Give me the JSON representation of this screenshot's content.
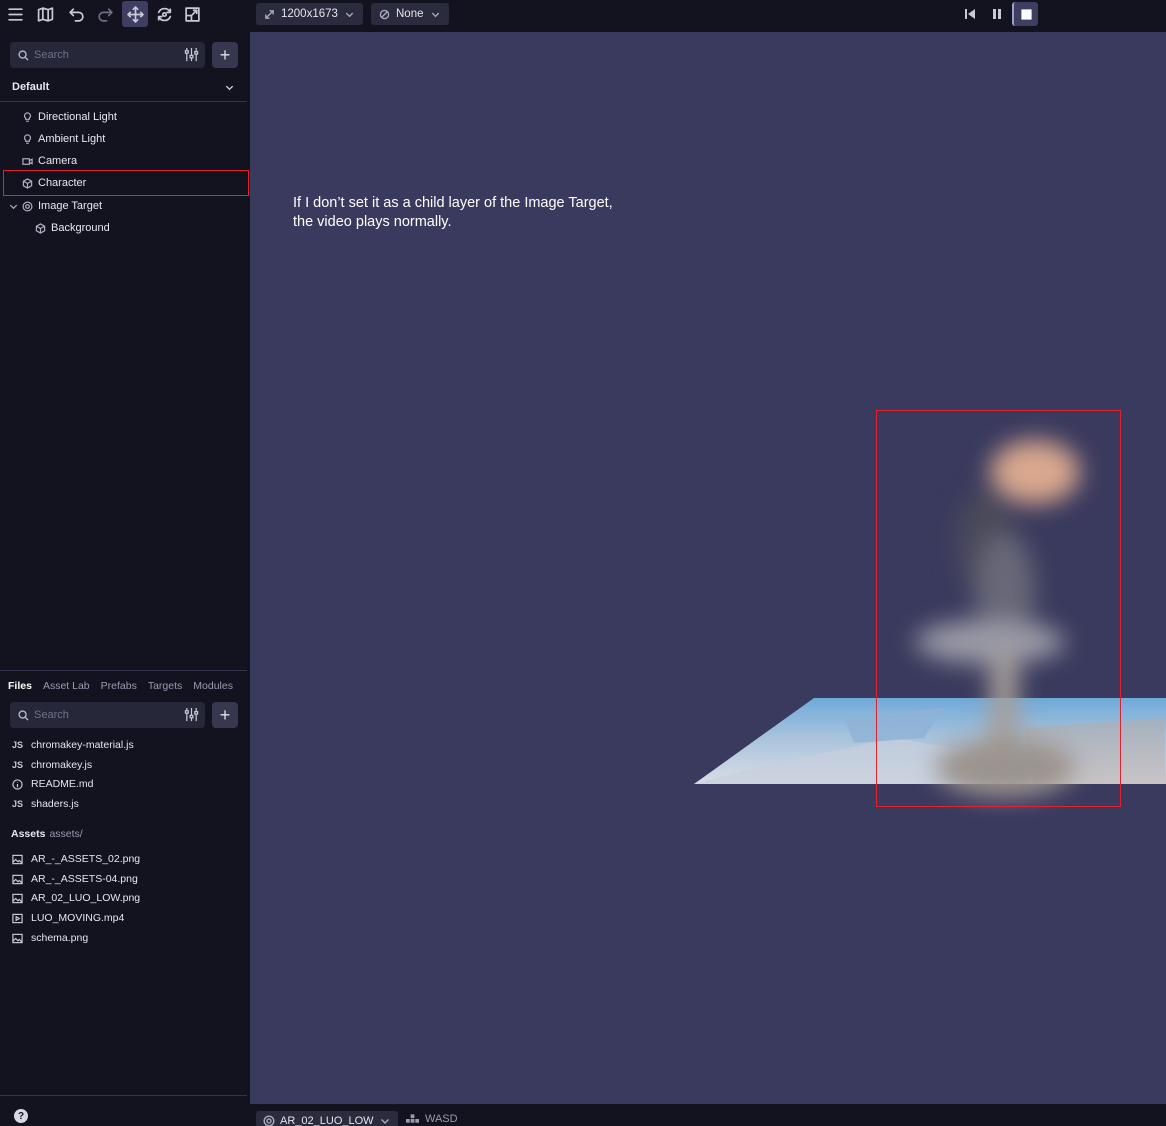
{
  "toolbar": {
    "resolution": "1200x1673",
    "camera_mode": "None",
    "icons": [
      "menu-icon",
      "map-icon",
      "undo-icon",
      "redo-icon",
      "move-icon",
      "orbit-icon",
      "scale-icon"
    ],
    "playback_icons": [
      "skip-back-icon",
      "pause-icon",
      "stop-icon"
    ]
  },
  "hierarchy": {
    "search_placeholder": "Search",
    "add_label": "+",
    "scene_name": "Default",
    "items": [
      {
        "label": "Directional Light",
        "icon": "bulb-icon"
      },
      {
        "label": "Ambient Light",
        "icon": "bulb-icon"
      },
      {
        "label": "Camera",
        "icon": "camera-icon"
      },
      {
        "label": "Character",
        "icon": "cube-icon"
      },
      {
        "label": "Image Target",
        "icon": "target-icon"
      },
      {
        "label": "Background",
        "icon": "cube-icon"
      }
    ]
  },
  "files_panel": {
    "tabs": [
      "Files",
      "Asset Lab",
      "Prefabs",
      "Targets",
      "Modules"
    ],
    "active_tab": "Files",
    "search_placeholder": "Search",
    "add_label": "+",
    "files": [
      {
        "name": "chromakey-material.js",
        "type": "JS"
      },
      {
        "name": "chromakey.js",
        "type": "JS"
      },
      {
        "name": "README.md",
        "type": "info"
      },
      {
        "name": "shaders.js",
        "type": "JS"
      }
    ],
    "assets_title": "Assets",
    "assets_path": "assets/",
    "assets": [
      {
        "name": "AR_-_ASSETS_02.png",
        "type": "image"
      },
      {
        "name": "AR_-_ASSETS-04.png",
        "type": "image"
      },
      {
        "name": "AR_02_LUO_LOW.png",
        "type": "image"
      },
      {
        "name": "LUO_MOVING.mp4",
        "type": "video"
      },
      {
        "name": "schema.png",
        "type": "image"
      }
    ],
    "help_label": "?"
  },
  "viewport": {
    "note_line1": "If I don’t set it as a child layer of the Image Target,",
    "note_line2": "the video plays normally.",
    "background_color": "#3a3a5e",
    "highlight_color": "#e0232f"
  },
  "bottom_bar": {
    "target_name": "AR_02_LUO_LOW",
    "controls_label": "WASD"
  }
}
